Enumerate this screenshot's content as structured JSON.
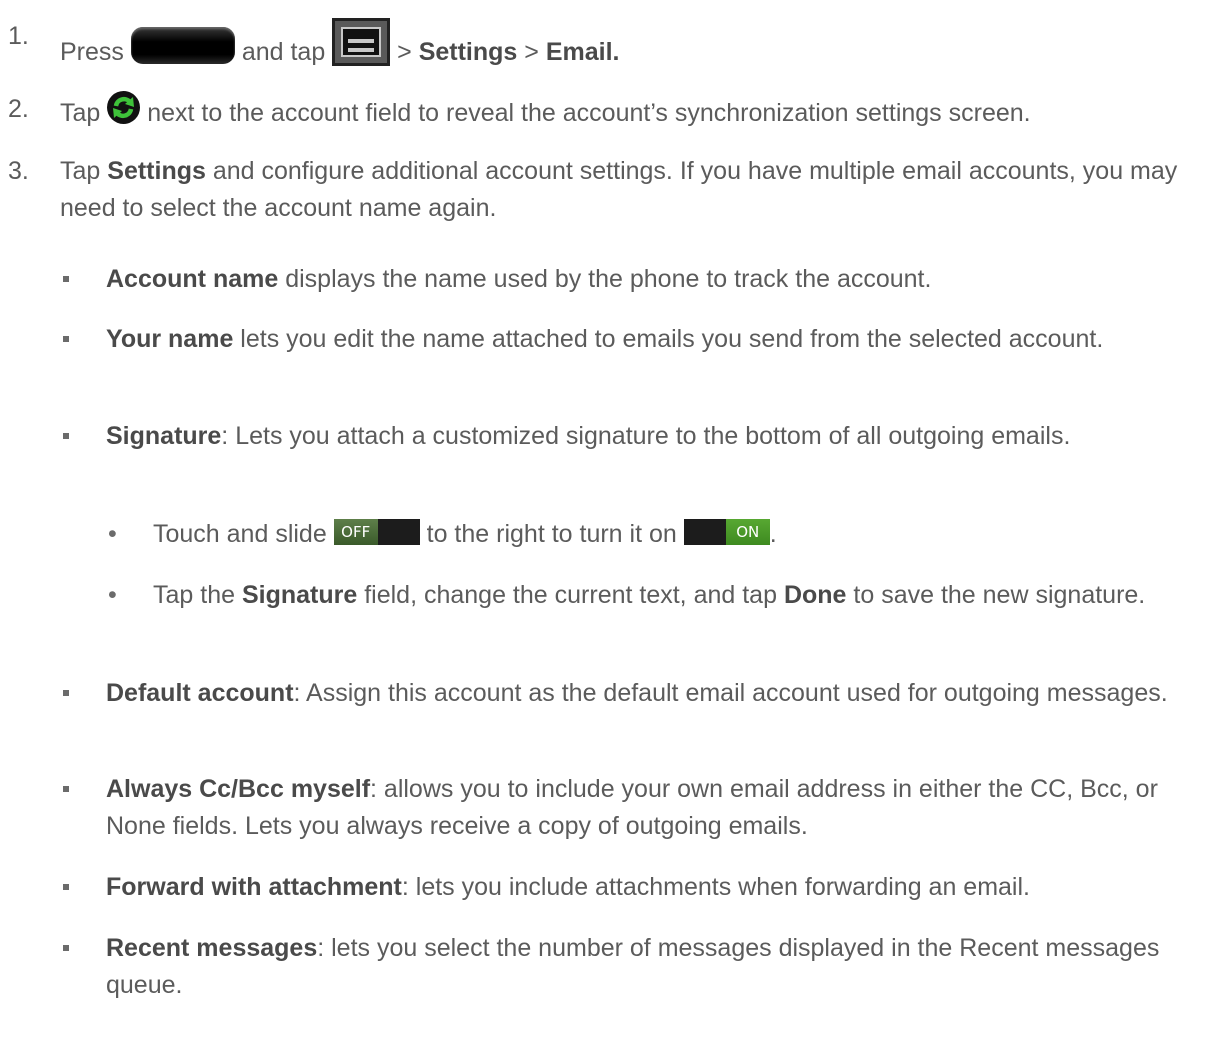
{
  "steps": [
    {
      "number": "1.",
      "press": "Press",
      "and_tap": "and tap",
      "sep1": ">",
      "settings": "Settings",
      "sep2": ">",
      "email": "Email."
    },
    {
      "number": "2.",
      "tap": "Tap",
      "rest": "next to the account field to reveal the account’s synchronization settings screen."
    },
    {
      "number": "3.",
      "tap": "Tap",
      "settings": "Settings",
      "rest": "and configure additional account settings. If you have multiple email accounts, you may need to select the account name again."
    }
  ],
  "bullets": [
    {
      "term": "Account name",
      "desc": " displays the name used by the phone to track the account."
    },
    {
      "term": "Your name",
      "desc": " lets you edit the name attached to emails you send from the selected account."
    },
    {
      "term": "Signature",
      "desc": ": Lets you attach a customized signature to the bottom of all outgoing emails."
    },
    {
      "term": "Default account",
      "desc": ": Assign this account as the default email account used for outgoing messages."
    },
    {
      "term": "Always Cc/Bcc myself",
      "desc": ": allows you to include your own email address in either the CC, Bcc, or None fields. Lets you always receive a copy of outgoing emails."
    },
    {
      "term": "Forward with attachment",
      "desc": ": lets you include attachments when forwarding an email."
    },
    {
      "term": "Recent messages",
      "desc": ": lets you select the number of messages displayed in the Recent messages queue."
    }
  ],
  "sub_bullets": [
    {
      "dot": "•",
      "before": "Touch and slide",
      "middle": "to the right to turn it on",
      "after": ".",
      "toggle_off_label": "OFF",
      "toggle_on_label": "ON"
    },
    {
      "dot": "•",
      "before": "Tap the",
      "field": "Signature",
      "middle": "field, change the current text, and tap",
      "done": "Done",
      "after": "to save the new signature."
    }
  ],
  "icons": {
    "home": "home-key-icon",
    "menu": "menu-key-icon",
    "sync": "sync-settings-icon"
  },
  "colors": {
    "text": "#5b5b5b",
    "sync_green": "#3ec23a",
    "toggle_on": "#4c9a28"
  }
}
